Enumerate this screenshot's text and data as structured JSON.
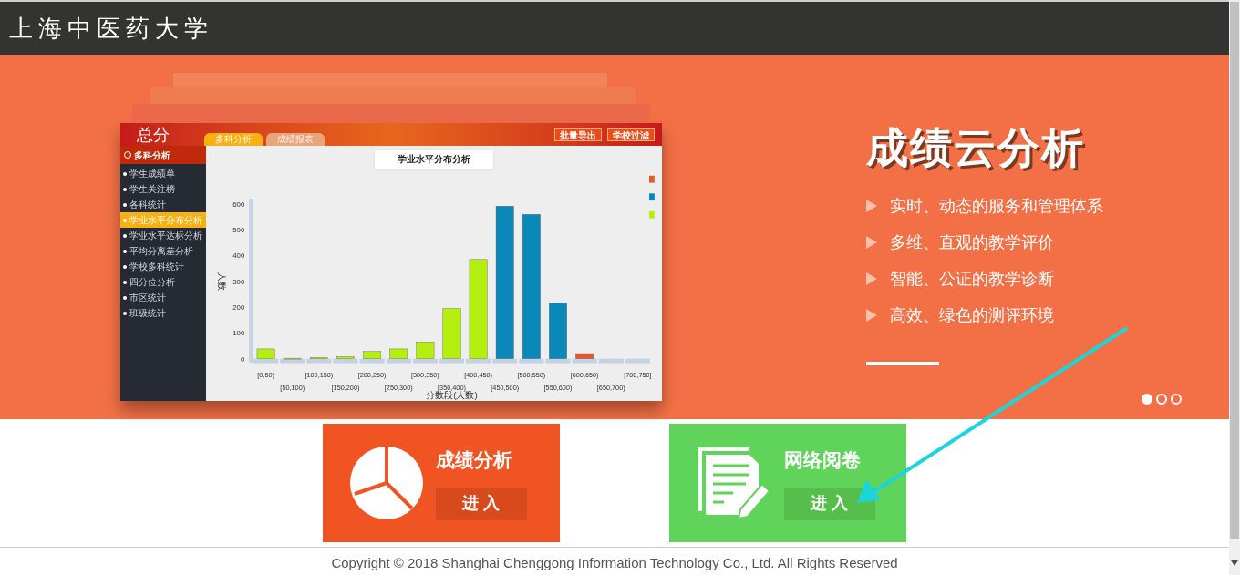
{
  "header": {
    "title": "上海中医药大学"
  },
  "banner": {
    "preview": {
      "logo": "总分",
      "tabs": [
        {
          "label": "多科分析",
          "selected": true
        },
        {
          "label": "成绩报表",
          "selected": false
        }
      ],
      "actions": [
        "批量导出",
        "学校过滤"
      ],
      "sidebar": {
        "title": "多科分析",
        "items": [
          {
            "label": "学生成绩单",
            "selected": false
          },
          {
            "label": "学生关注榜",
            "selected": false
          },
          {
            "label": "各科统计",
            "selected": false
          },
          {
            "label": "学业水平分布分析",
            "selected": true
          },
          {
            "label": "学业水平达标分析",
            "selected": false
          },
          {
            "label": "平均分离差分析",
            "selected": false
          },
          {
            "label": "学校多科统计",
            "selected": false
          },
          {
            "label": "四分位分析",
            "selected": false
          },
          {
            "label": "市区统计",
            "selected": false
          },
          {
            "label": "班级统计",
            "selected": false
          }
        ]
      },
      "chart_title": "学业水平分布分析",
      "chart_data": {
        "type": "bar",
        "xlabel": "分数段(人数)",
        "ylabel": "人数",
        "stacked": true,
        "categories": [
          "[0,50)",
          "[50,100)",
          "[100,150)",
          "[150,200)",
          "[200,250)",
          "[250,300)",
          "[300,350)",
          "[350,400)",
          "[400,450)",
          "[450,500)",
          "[500,550)",
          "[550,600)",
          "[600,650)",
          "[650,700)",
          "[700,750]"
        ],
        "series": [
          {
            "color": "#e8592a",
            "values": [
              null,
              null,
              null,
              null,
              null,
              null,
              null,
              null,
              null,
              null,
              null,
              null,
              20,
              null,
              null
            ]
          },
          {
            "color": "#0a89b8",
            "values": [
              null,
              null,
              null,
              null,
              null,
              null,
              null,
              null,
              null,
              592,
              560,
              217,
              null,
              null,
              null
            ]
          },
          {
            "color": "#b5ef0f",
            "values": [
              38,
              2,
              5,
              8,
              28,
              38,
              65,
              195,
              385,
              null,
              null,
              null,
              null,
              null,
              null
            ]
          }
        ],
        "ylim": [
          0,
          600
        ],
        "yticks": [
          0,
          100,
          200,
          300,
          400,
          500,
          600
        ]
      }
    },
    "heading": "成绩云分析",
    "features": [
      "实时、动态的服务和管理体系",
      "多维、直观的教学评价",
      "智能、公证的教学诊断",
      "高效、绿色的测评环境"
    ],
    "dots": [
      {
        "selected": true
      },
      {
        "selected": false
      },
      {
        "selected": false
      }
    ]
  },
  "cards": [
    {
      "kind": "chart",
      "title": "成绩分析",
      "button": "进 入"
    },
    {
      "kind": "document",
      "title": "网络阅卷",
      "button": "进 入"
    }
  ],
  "footer": "Copyright © 2018 Shanghai Chenggong Information Technology Co., Ltd. All Rights Reserved"
}
